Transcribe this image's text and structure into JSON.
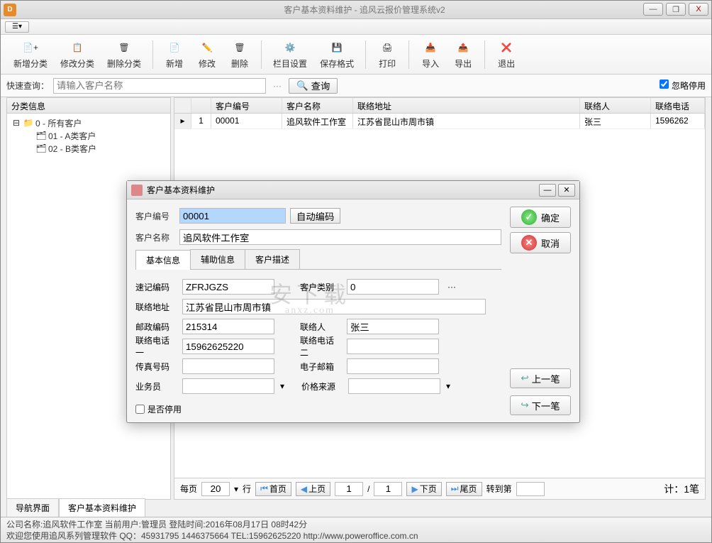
{
  "title": "客户基本资料维护 - 追风云报价管理系统v2",
  "title_controls": {
    "min": "—",
    "max": "❐",
    "close": "X"
  },
  "ribbon": [
    {
      "label": "新增分类"
    },
    {
      "label": "修改分类"
    },
    {
      "label": "删除分类"
    },
    {
      "sep": true
    },
    {
      "label": "新增"
    },
    {
      "label": "修改"
    },
    {
      "label": "删除"
    },
    {
      "sep": true
    },
    {
      "label": "栏目设置"
    },
    {
      "label": "保存格式"
    },
    {
      "sep": true
    },
    {
      "label": "打印"
    },
    {
      "sep": true
    },
    {
      "label": "导入"
    },
    {
      "label": "导出"
    },
    {
      "sep": true
    },
    {
      "label": "退出"
    }
  ],
  "search": {
    "label": "快速查询：",
    "placeholder": "请输入客户名称",
    "query_btn": "查询",
    "ignore_disabled": "忽略停用",
    "ignore_checked": true
  },
  "tree": {
    "header": "分类信息",
    "items": [
      {
        "text": "0 - 所有客户",
        "lvl": 0
      },
      {
        "text": "01 - A类客户",
        "lvl": 1
      },
      {
        "text": "02 - B类客户",
        "lvl": 1
      }
    ]
  },
  "grid": {
    "cols": [
      "",
      "",
      "客户编号",
      "客户名称",
      "联络地址",
      "联络人",
      "联络电话"
    ],
    "rows": [
      {
        "n": "1",
        "code": "00001",
        "name": "追风软件工作室",
        "addr": "江苏省昆山市周市镇",
        "contact": "张三",
        "tel": "1596262"
      }
    ]
  },
  "pager": {
    "per_page_lbl": "每页",
    "per_page": "20",
    "rows_lbl": "行",
    "first": "首页",
    "prev": "上页",
    "cur": "1",
    "sep": "/",
    "total": "1",
    "next": "下页",
    "last": "尾页",
    "goto_lbl": "转到第",
    "count": "计：1笔"
  },
  "tabs": {
    "nav": "导航界面",
    "main": "客户基本资料维护"
  },
  "status": {
    "line1": "公司名称:追风软件工作室 当前用户:管理员 登陆时间:2016年08月17日 08时42分",
    "line2": "欢迎您使用追风系列管理软件 QQ：45931795 1446375664 TEL:15962625220 http://www.poweroffice.com.cn"
  },
  "dialog": {
    "title": "客户基本资料维护",
    "code_lbl": "客户编号",
    "code_val": "00001",
    "auto": "自动编码",
    "name_lbl": "客户名称",
    "name_val": "追风软件工作室",
    "ok": "确定",
    "cancel": "取消",
    "prev": "上一笔",
    "next": "下一笔",
    "tabs": [
      "基本信息",
      "辅助信息",
      "客户描述"
    ],
    "fields": {
      "mnemonic_lbl": "速记编码",
      "mnemonic": "ZFRJGZS",
      "category_lbl": "客户类别",
      "category": "0",
      "addr_lbl": "联络地址",
      "addr": "江苏省昆山市周市镇",
      "zip_lbl": "邮政编码",
      "zip": "215314",
      "contact_lbl": "联络人",
      "contact": "张三",
      "tel1_lbl": "联络电话一",
      "tel1": "15962625220",
      "tel2_lbl": "联络电话二",
      "tel2": "",
      "fax_lbl": "传真号码",
      "fax": "",
      "email_lbl": "电子邮箱",
      "email": "",
      "sales_lbl": "业务员",
      "sales": "",
      "price_lbl": "价格来源",
      "price": "",
      "disabled_lbl": "是否停用"
    }
  },
  "watermark": {
    "main": "安下载",
    "sub": "anxz.com"
  }
}
